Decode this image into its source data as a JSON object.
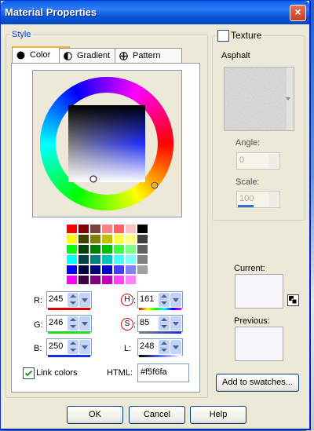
{
  "window": {
    "title": "Material Properties",
    "close_symbol": "×"
  },
  "style_group": {
    "label": "Style"
  },
  "tabs": [
    {
      "label": "Color",
      "active": true
    },
    {
      "label": "Gradient",
      "active": false
    },
    {
      "label": "Pattern",
      "active": false
    }
  ],
  "fields": {
    "r": {
      "label": "R:",
      "value": "245"
    },
    "g": {
      "label": "G:",
      "value": "246"
    },
    "b": {
      "label": "B:",
      "value": "250"
    },
    "h": {
      "label": "H",
      "value": "161"
    },
    "s": {
      "label": "S",
      "value": "85"
    },
    "l": {
      "label": "L:",
      "value": "248"
    },
    "h_colon": ":",
    "s_colon": ":"
  },
  "link_colors": {
    "label": "Link colors",
    "checked": true
  },
  "html": {
    "label": "HTML:",
    "value": "#f5f6fa"
  },
  "texture": {
    "label": "Texture",
    "checked": false,
    "name": "Asphalt",
    "angle_label": "Angle:",
    "angle_value": "0",
    "scale_label": "Scale:",
    "scale_value": "100"
  },
  "current": {
    "label": "Current:",
    "color": "#f6f6fa"
  },
  "previous": {
    "label": "Previous:",
    "color": "#f6f6fa"
  },
  "buttons": {
    "add_swatches": "Add to swatches...",
    "ok": "OK",
    "cancel": "Cancel",
    "help": "Help"
  },
  "palette_colors": [
    [
      "#ff0000",
      "#800000",
      "#804040",
      "#ff8080",
      "#ff6060",
      "#ffc0c0",
      "#000000"
    ],
    [
      "#ffff00",
      "#404000",
      "#808000",
      "#c0c000",
      "#ffff40",
      "#ffff80",
      "#404040"
    ],
    [
      "#00ff00",
      "#004000",
      "#008000",
      "#00c000",
      "#40ff40",
      "#80ff80",
      "#606060"
    ],
    [
      "#00ffff",
      "#004040",
      "#008080",
      "#00c0c0",
      "#40ffff",
      "#80ffff",
      "#808080"
    ],
    [
      "#0000ff",
      "#000040",
      "#000080",
      "#0000c0",
      "#4040ff",
      "#8080ff",
      "#a0a0a0"
    ],
    [
      "#ff00ff",
      "#400040",
      "#800080",
      "#c000c0",
      "#ff40ff",
      "#ff80ff",
      "#ffffff"
    ]
  ]
}
